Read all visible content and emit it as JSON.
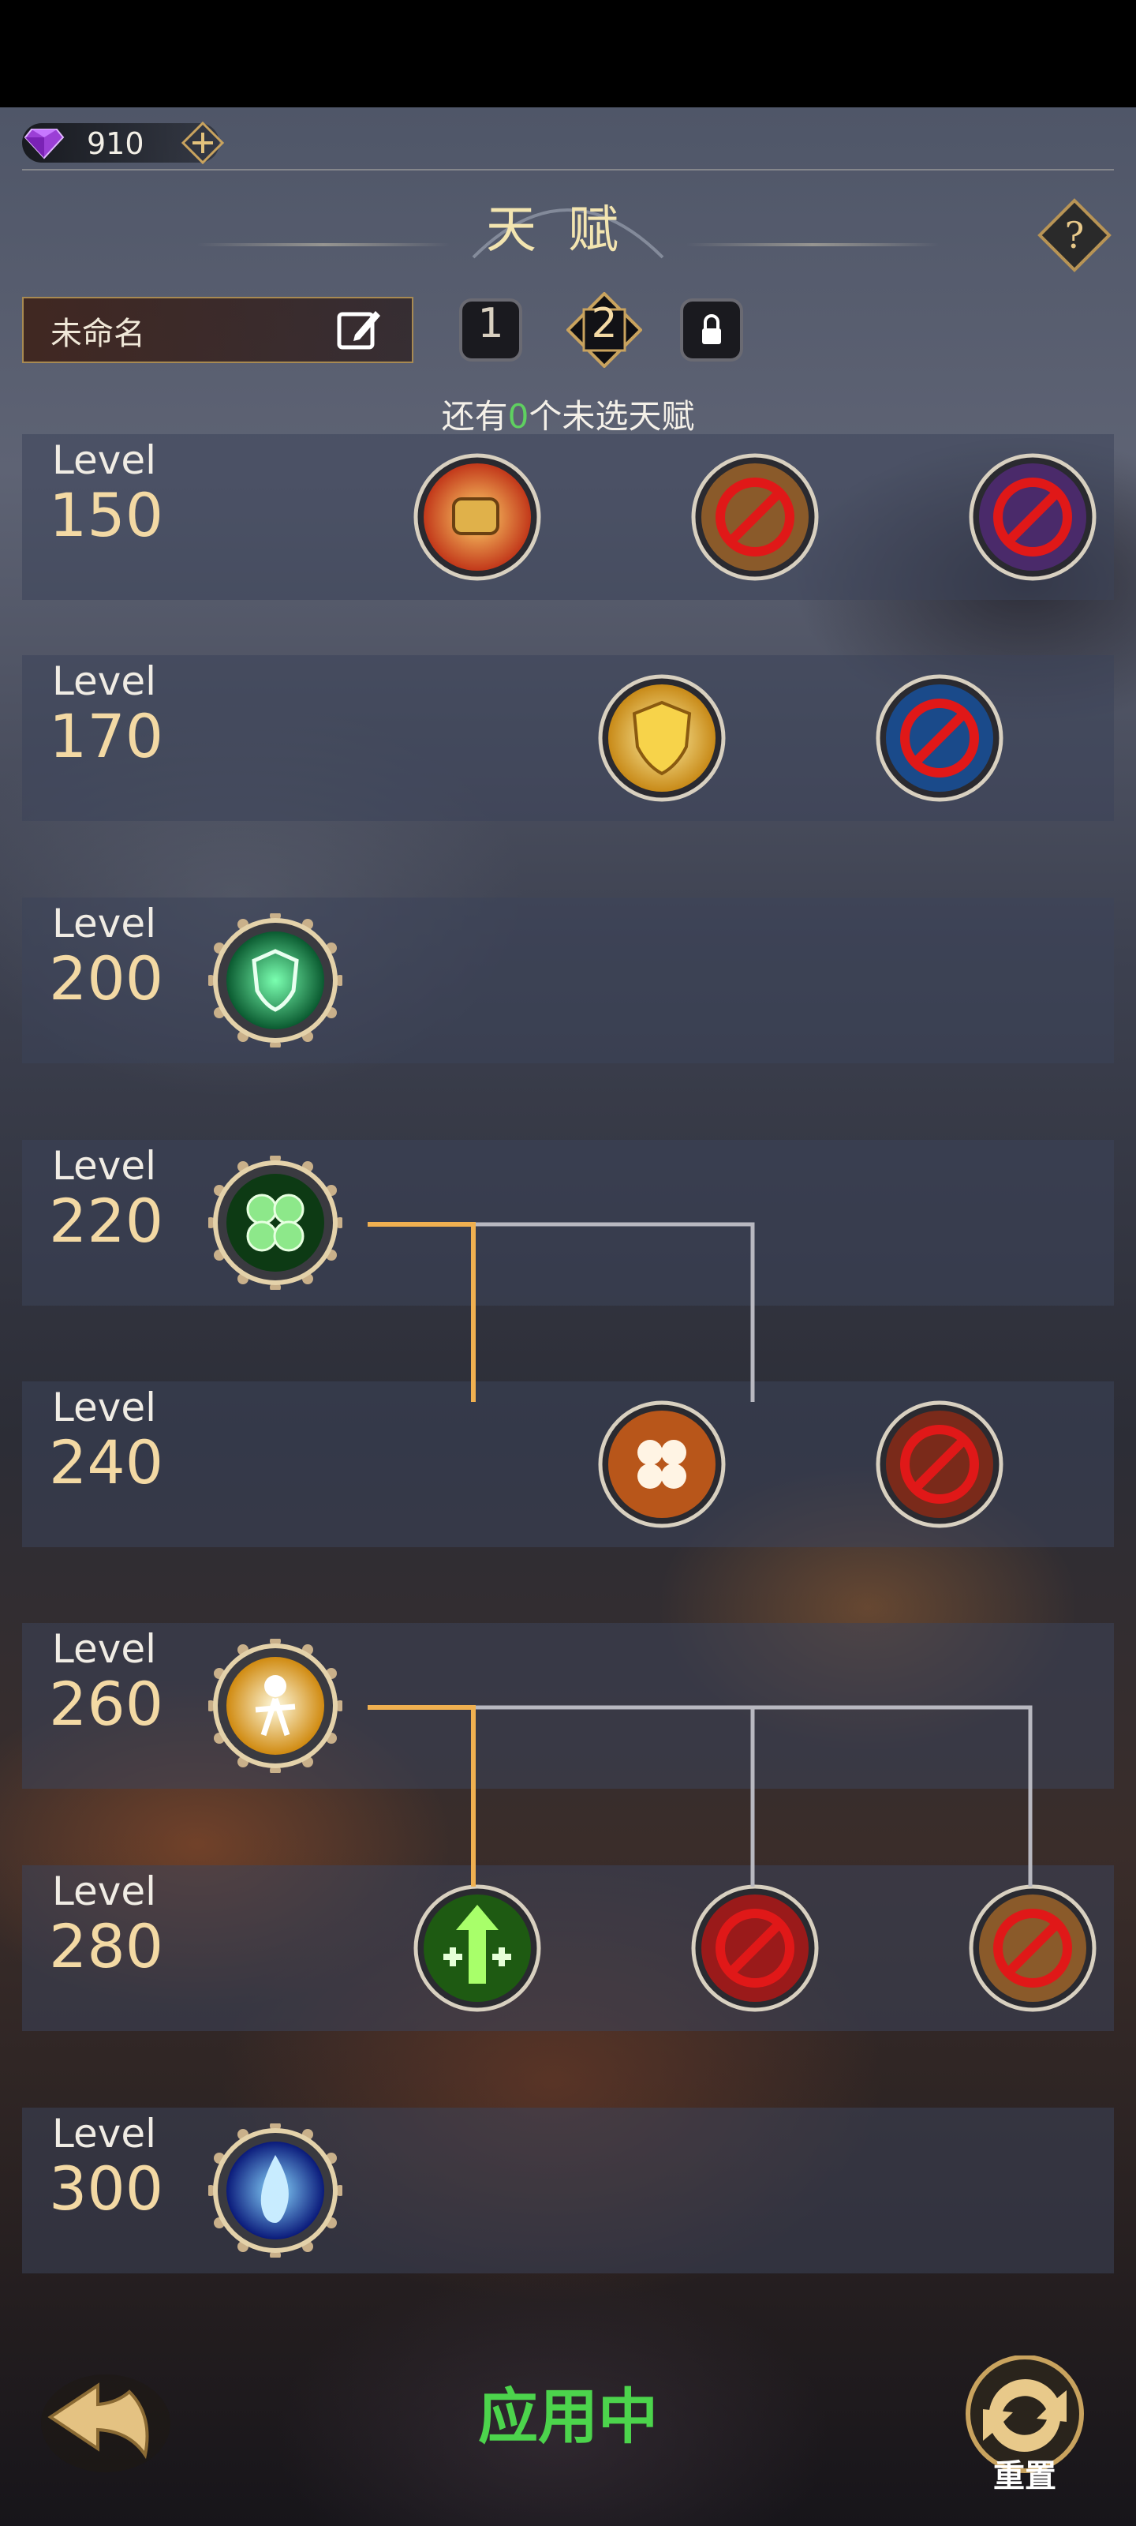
{
  "currency": {
    "amount": "910",
    "icon": "purple-gem-icon"
  },
  "header": {
    "title": "天赋",
    "help_label": "?"
  },
  "build": {
    "name": "未命名",
    "slots": [
      "1",
      "2"
    ],
    "active_slot": "2",
    "locked_slot_icon": "lock-icon"
  },
  "remaining": {
    "prefix": "还有",
    "count": "0",
    "suffix": "个未选天赋"
  },
  "level_word": "Level",
  "rows": [
    {
      "level": "150",
      "talents": [
        {
          "icon": "flaming-fist-icon",
          "state": "selected"
        },
        {
          "icon": "forbidden-icon",
          "state": "disabled"
        },
        {
          "icon": "forbidden-icon",
          "state": "disabled"
        }
      ]
    },
    {
      "level": "170",
      "talents": [
        {
          "icon": "golden-shield-icon",
          "state": "selected"
        },
        {
          "icon": "forbidden-icon",
          "state": "disabled"
        }
      ]
    },
    {
      "level": "200",
      "talents": [
        {
          "icon": "green-fist-shield-icon",
          "state": "core"
        }
      ]
    },
    {
      "level": "220",
      "talents": [
        {
          "icon": "four-leaf-clover-icon",
          "state": "core"
        }
      ]
    },
    {
      "level": "240",
      "talents": [
        {
          "icon": "orange-clover-icon",
          "state": "selected"
        },
        {
          "icon": "forbidden-icon",
          "state": "disabled"
        }
      ]
    },
    {
      "level": "260",
      "talents": [
        {
          "icon": "radiant-figure-icon",
          "state": "core"
        }
      ]
    },
    {
      "level": "280",
      "talents": [
        {
          "icon": "green-arrow-heal-icon",
          "state": "selected"
        },
        {
          "icon": "forbidden-icon",
          "state": "disabled"
        },
        {
          "icon": "forbidden-icon",
          "state": "disabled"
        }
      ]
    },
    {
      "level": "300",
      "talents": [
        {
          "icon": "blue-frost-flame-icon",
          "state": "core"
        }
      ]
    }
  ],
  "footer": {
    "status": "应用中",
    "reset_label": "重置",
    "back_icon": "back-arrow-icon"
  },
  "colors": {
    "accent_gold": "#f3d9a4",
    "status_green": "#4cd44c",
    "remaining_green": "#5fd060"
  }
}
